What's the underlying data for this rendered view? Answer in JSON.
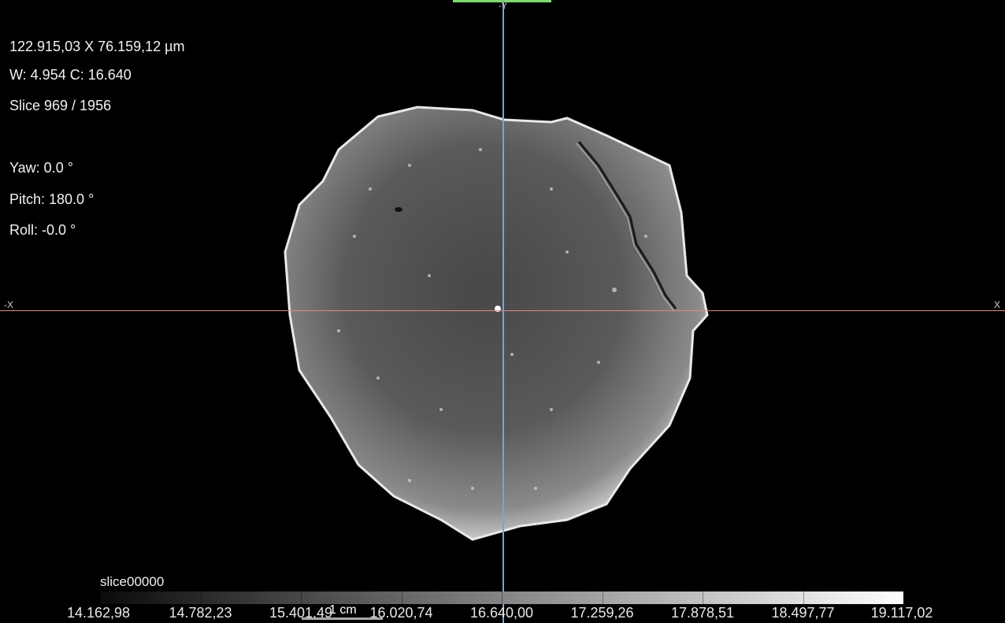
{
  "overlay": {
    "dimensions": "122.915,03 X 76.159,12 µm",
    "window_center": "W: 4.954 C: 16.640",
    "slice": "Slice 969 / 1956",
    "yaw": "Yaw: 0.0 °",
    "pitch": "Pitch: 180.0 °",
    "roll": "Roll: -0.0 °"
  },
  "axes": {
    "neg_x": "-X",
    "pos_x": "X",
    "neg_y": "-Y"
  },
  "colors": {
    "horizontal_crosshair": "#e08a8a",
    "vertical_crosshair": "#6fa6e6",
    "top_indicator": "#7fdc6a"
  },
  "colorbar": {
    "title": "slice00000",
    "ticks": [
      "14.162,98",
      "14.782,23",
      "15.401,49",
      "16.020,74",
      "16.640,00",
      "17.259,26",
      "17.878,51",
      "18.497,77",
      "19.117,02"
    ]
  },
  "scale_bar": {
    "label": "1 cm"
  }
}
